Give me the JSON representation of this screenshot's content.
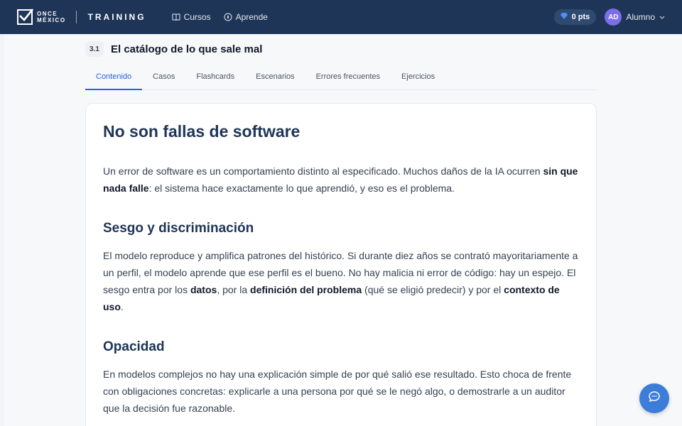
{
  "header": {
    "logo_line1": "ONCE",
    "logo_line2": "MÉXICO",
    "logo_training": "TRAINING",
    "nav": [
      {
        "label": "Cursos",
        "icon": "book-icon"
      },
      {
        "label": "Aprende",
        "icon": "compass-icon"
      }
    ],
    "points": "0 pts",
    "avatar_initials": "AD",
    "user_name": "Alumno"
  },
  "section": {
    "number": "3.1",
    "title": "El catálogo de lo que sale mal"
  },
  "tabs": [
    "Contenido",
    "Casos",
    "Flashcards",
    "Escenarios",
    "Errores frecuentes",
    "Ejercicios"
  ],
  "active_tab": "Contenido",
  "content": {
    "heading": "No son fallas de software",
    "intro": {
      "a": "Un error de software es un comportamiento distinto al especificado. Muchos daños de la IA ocurren ",
      "b": "sin que nada falle",
      "c": ": el sistema hace exactamente lo que aprendió, y eso es el problema."
    },
    "sesgo_heading": "Sesgo y discriminación",
    "sesgo": {
      "a": "El modelo reproduce y amplifica patrones del histórico. Si durante diez años se contrató mayoritariamente a un perfil, el modelo aprende que ese perfil es el bueno. No hay malicia ni error de código: hay un espejo. El sesgo entra por los ",
      "b": "datos",
      "c": ", por la ",
      "d": "definición del problema",
      "e": " (qué se eligió predecir) y por el ",
      "f": "contexto de uso",
      "g": "."
    },
    "opacidad_heading": "Opacidad",
    "opacidad": "En modelos complejos no hay una explicación simple de por qué salió ese resultado. Esto choca de frente con obligaciones concretas: explicarle a una persona por qué se le negó algo, o demostrarle a un auditor que la decisión fue razonable."
  },
  "colors": {
    "header_bg": "#1e3557",
    "accent": "#2563eb",
    "heading": "#1e3557",
    "fab": "#3b7dd8",
    "avatar": "#7b6ee8"
  }
}
